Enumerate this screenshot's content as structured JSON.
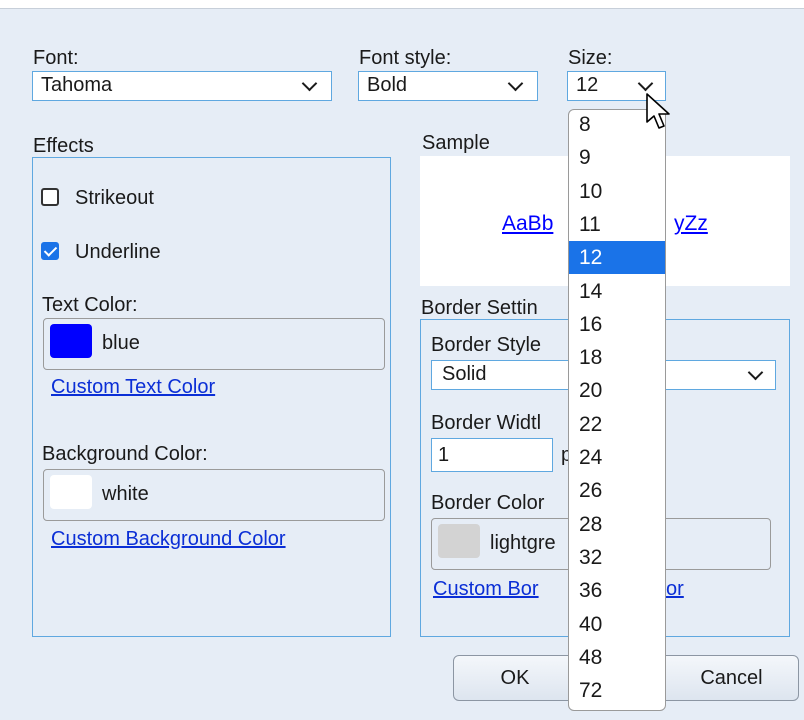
{
  "font": {
    "label": "Font:",
    "value": "Tahoma"
  },
  "font_style": {
    "label": "Font style:",
    "value": "Bold"
  },
  "size": {
    "label": "Size:",
    "value": "12",
    "options": [
      "8",
      "9",
      "10",
      "11",
      "12",
      "14",
      "16",
      "18",
      "20",
      "22",
      "24",
      "26",
      "28",
      "32",
      "36",
      "40",
      "48",
      "72"
    ],
    "selected": "12"
  },
  "effects": {
    "title": "Effects",
    "strikeout": {
      "label": "Strikeout",
      "checked": false
    },
    "underline": {
      "label": "Underline",
      "checked": true
    },
    "text_color": {
      "label": "Text Color:",
      "name": "blue",
      "swatch": "#0000ff",
      "custom_link": "Custom Text Color"
    },
    "background_color": {
      "label": "Background Color:",
      "name": "white",
      "swatch": "#ffffff",
      "custom_link": "Custom Background Color"
    }
  },
  "sample": {
    "title": "Sample",
    "text_left": "AaBb",
    "text_right": "yZz",
    "color": "#0000ff"
  },
  "border": {
    "title": "Border Settin",
    "style_label": "Border Style",
    "style_value": "Solid",
    "width_label": "Border Widtl",
    "width_value": "1",
    "width_unit": "p",
    "color_label": "Border Color",
    "color_name": "lightgre",
    "color_swatch": "#d3d3d3",
    "custom_link_left": "Custom Bor",
    "custom_link_right": "or"
  },
  "buttons": {
    "ok": "OK",
    "cancel": "Cancel"
  }
}
